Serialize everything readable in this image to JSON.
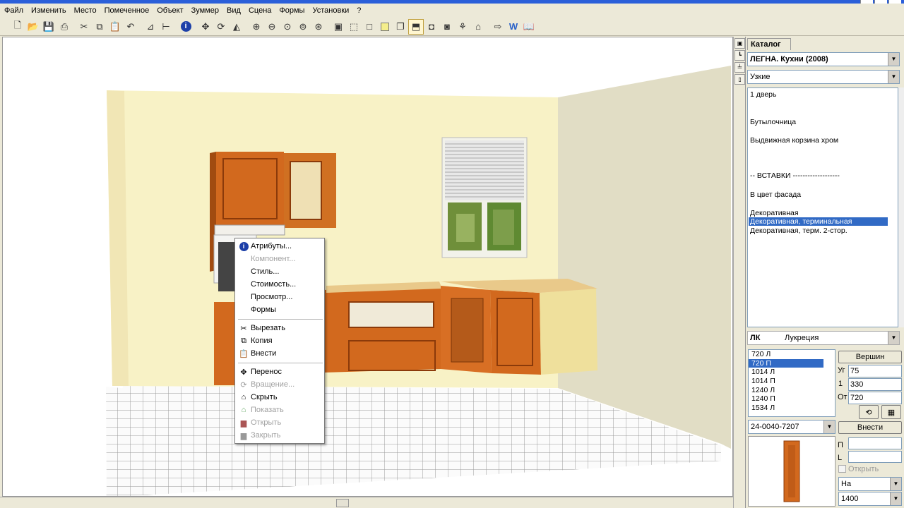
{
  "menu": [
    "Файл",
    "Изменить",
    "Место",
    "Помеченное",
    "Объект",
    "Зуммер",
    "Вид",
    "Сцена",
    "Формы",
    "Установки",
    "?"
  ],
  "toolbar_icons": [
    "new-icon",
    "open-icon",
    "save-icon",
    "print-icon",
    "cut-icon",
    "copy-icon",
    "paste-icon",
    "undo-icon",
    "dimension-icon",
    "measure-icon",
    "info-icon",
    "move-icon",
    "rotate-icon",
    "mirror-icon",
    "zoom-in-icon",
    "zoom-out-icon",
    "zoom-fit-icon",
    "zoom-window-icon",
    "zoom-all-icon",
    "render-icon",
    "frame-icon",
    "box-icon",
    "fill-icon",
    "layers-icon",
    "3d-box-icon",
    "camera-icon",
    "walk-icon",
    "shade-icon",
    "export-icon",
    "word-icon",
    "book-icon"
  ],
  "catalog": {
    "tab": "Каталог",
    "library": "ЛЕГНА. Кухни (2008)",
    "category": "Узкие",
    "items": [
      {
        "text": "1 дверь",
        "selected": false
      },
      {
        "text": "Бутылочница",
        "selected": false
      },
      {
        "text": "Выдвижная корзина хром",
        "selected": false
      },
      {
        "text": "-- ВСТАВКИ -------------------",
        "selected": false
      },
      {
        "text": "В цвет фасада",
        "selected": false
      },
      {
        "text": "Декоративная",
        "selected": false
      },
      {
        "text": "Декоративная, терминальная",
        "selected": true
      },
      {
        "text": "Декоративная, терм. 2-стор.",
        "selected": false
      }
    ]
  },
  "material": {
    "code": "ЛК",
    "name": "Лукреция"
  },
  "sizes": [
    {
      "text": "720  Л",
      "selected": false
    },
    {
      "text": "720  П",
      "selected": true
    },
    {
      "text": "1014  Л",
      "selected": false
    },
    {
      "text": "1014  П",
      "selected": false
    },
    {
      "text": "1240  Л",
      "selected": false
    },
    {
      "text": "1240  П",
      "selected": false
    },
    {
      "text": "1534  Л",
      "selected": false
    }
  ],
  "article": "24-0040-7207",
  "buttons": {
    "vertex": "Вершин",
    "insert": "Внести"
  },
  "params": {
    "angle_label": "Уг",
    "angle": "75",
    "len_label": "1",
    "len": "330",
    "from_label": "От",
    "from": "720"
  },
  "bottom": {
    "p_label": "П",
    "l_label": "L",
    "open_label": "Открыть",
    "on_value": "На",
    "height_value": "1400"
  },
  "context_menu": [
    {
      "label": "Атрибуты...",
      "icon": "info-icon",
      "enabled": true
    },
    {
      "label": "Компонент...",
      "icon": "",
      "enabled": false
    },
    {
      "label": "Стиль...",
      "icon": "",
      "enabled": true
    },
    {
      "label": "Стоимость...",
      "icon": "",
      "enabled": true
    },
    {
      "label": "Просмотр...",
      "icon": "",
      "enabled": true
    },
    {
      "label": "Формы",
      "icon": "",
      "enabled": true
    },
    {
      "label": "Вырезать",
      "icon": "cut-icon",
      "enabled": true
    },
    {
      "label": "Копия",
      "icon": "copy-icon",
      "enabled": true
    },
    {
      "label": "Внести",
      "icon": "paste-icon",
      "enabled": true
    },
    {
      "label": "Перенос",
      "icon": "move-icon",
      "enabled": true
    },
    {
      "label": "Вращение...",
      "icon": "rotate-icon",
      "enabled": false
    },
    {
      "label": "Скрыть",
      "icon": "hide-icon",
      "enabled": true
    },
    {
      "label": "Показать",
      "icon": "show-icon",
      "enabled": false
    },
    {
      "label": "Открыть",
      "icon": "open-door-icon",
      "enabled": false
    },
    {
      "label": "Закрыть",
      "icon": "close-door-icon",
      "enabled": false
    }
  ],
  "colors": {
    "wall": "#f7f0c4",
    "wall_side": "#e0dcc4",
    "cabinet": "#d2691e",
    "selection": "#316ac5"
  }
}
